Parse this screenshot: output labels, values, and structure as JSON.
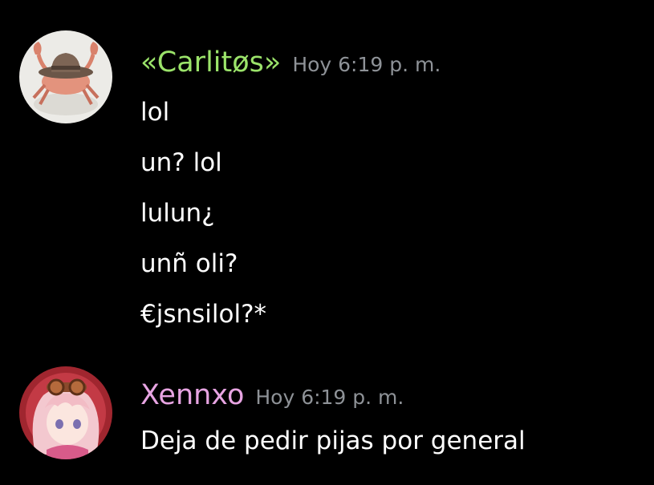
{
  "colors": {
    "background": "#000000",
    "message_text": "#ffffff",
    "timestamp": "#8e9297"
  },
  "messages": [
    {
      "author": "«Carlitøs»",
      "author_color": "#9be36a",
      "avatar_icon": "crab-with-cowboy-hat-avatar",
      "timestamp": "Hoy 6:19 p. m.",
      "lines": [
        "lol",
        "un? lol",
        "lulun¿",
        "unñ oli?",
        "€jsnsilol?*"
      ]
    },
    {
      "author": "Xennxo",
      "author_color": "#e7a4e2",
      "avatar_icon": "anime-girl-with-goggles-avatar",
      "timestamp": "Hoy 6:19 p. m.",
      "lines": [
        "Deja de pedir pijas por general"
      ]
    }
  ]
}
